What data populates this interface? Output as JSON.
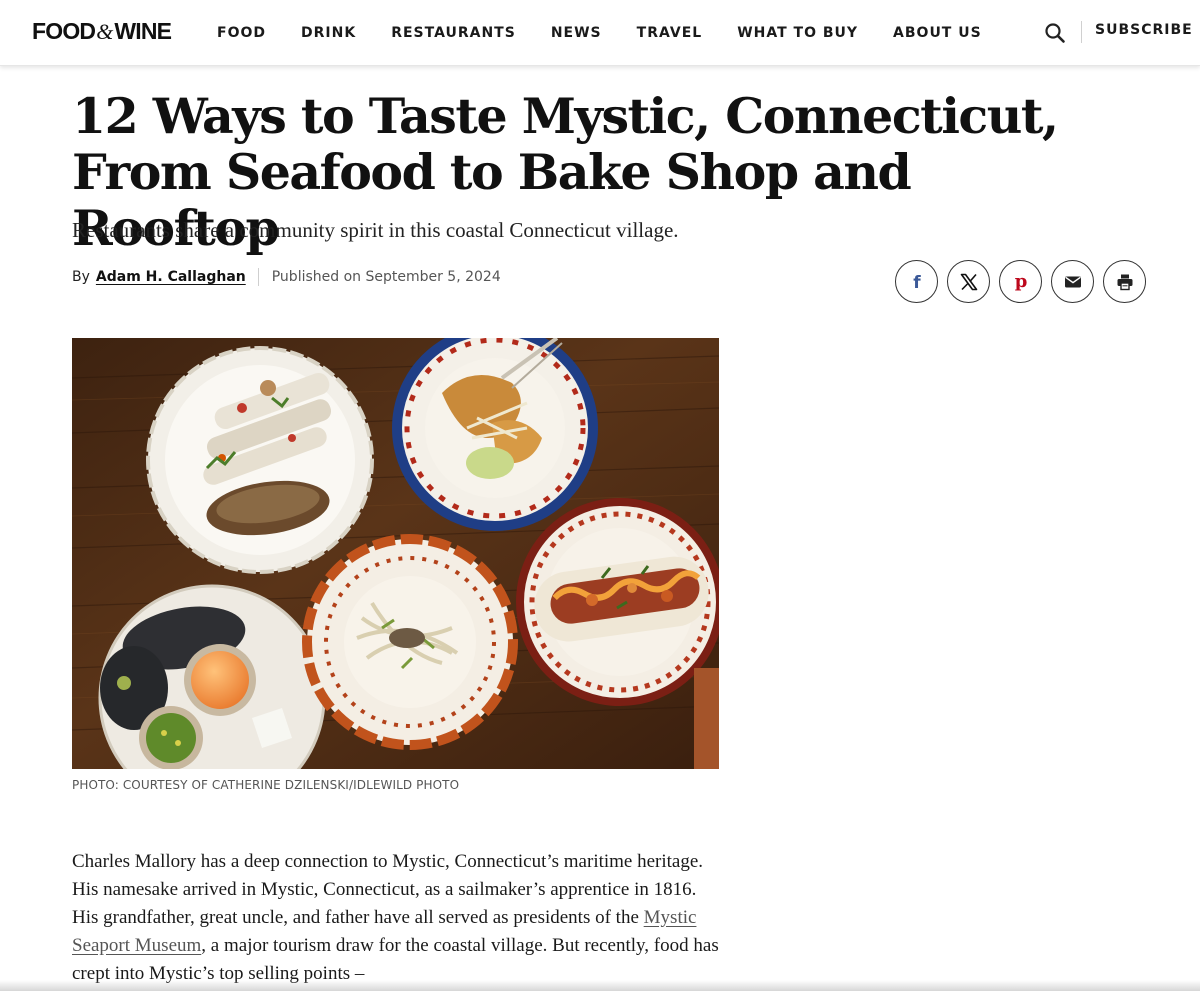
{
  "header": {
    "logo": {
      "left": "FOOD",
      "amp": "&",
      "right": "WINE"
    },
    "nav": [
      {
        "label": "FOOD"
      },
      {
        "label": "DRINK"
      },
      {
        "label": "RESTAURANTS"
      },
      {
        "label": "NEWS"
      },
      {
        "label": "TRAVEL"
      },
      {
        "label": "WHAT TO BUY"
      },
      {
        "label": "ABOUT US"
      }
    ],
    "search_icon": "search-icon",
    "subscribe_label": "SUBSCRIBE"
  },
  "article": {
    "headline": "12 Ways to Taste Mystic, Connecticut, From Seafood to Bake Shop and Rooftop",
    "dek": "Restaurants share a community spirit in this coastal Connecticut village.",
    "byline": {
      "by_label": "By",
      "author": "Adam H. Callaghan",
      "published": "Published on September 5, 2024"
    },
    "share_icons": [
      "facebook-icon",
      "x-icon",
      "pinterest-icon",
      "email-icon",
      "print-icon"
    ],
    "share_labels": {
      "facebook": "f",
      "pinterest": "p"
    },
    "hero_caption": "PHOTO: COURTESY OF CATHERINE DZILENSKI/IDLEWILD PHOTO",
    "body": {
      "before_link": "Charles Mallory has a deep connection to Mystic, Connecticut’s maritime heritage. His namesake arrived in Mystic, Connecticut, as a sailmaker’s apprentice in 1816. His grandfather, great uncle, and father have all served as presidents of the ",
      "link_text": "Mystic Seaport Museum",
      "after_link": ", a major tourism draw for the coastal village. But recently, food has crept into Mystic’s top selling points –"
    }
  },
  "colors": {
    "text": "#111111",
    "muted": "#555555",
    "pinterest": "#bd081c",
    "facebook": "#3b5998",
    "wood": "#4a2a14"
  }
}
